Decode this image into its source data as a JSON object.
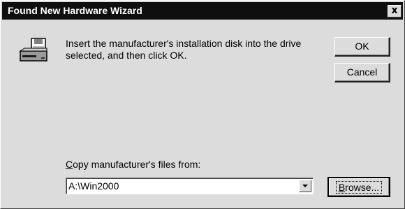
{
  "window": {
    "title": "Found New Hardware Wizard",
    "close_glyph": "x"
  },
  "message": "Insert the manufacturer's installation disk into the drive selected, and then click OK.",
  "buttons": {
    "ok": "OK",
    "cancel": "Cancel",
    "browse_underlined": "B",
    "browse_rest": "rowse..."
  },
  "copy_from": {
    "label_underlined": "C",
    "label_rest": "opy manufacturer's files from:",
    "value": "A:\\Win2000"
  },
  "icons": {
    "disk": "disk-drive-icon",
    "dropdown": "dropdown-arrow-icon"
  }
}
